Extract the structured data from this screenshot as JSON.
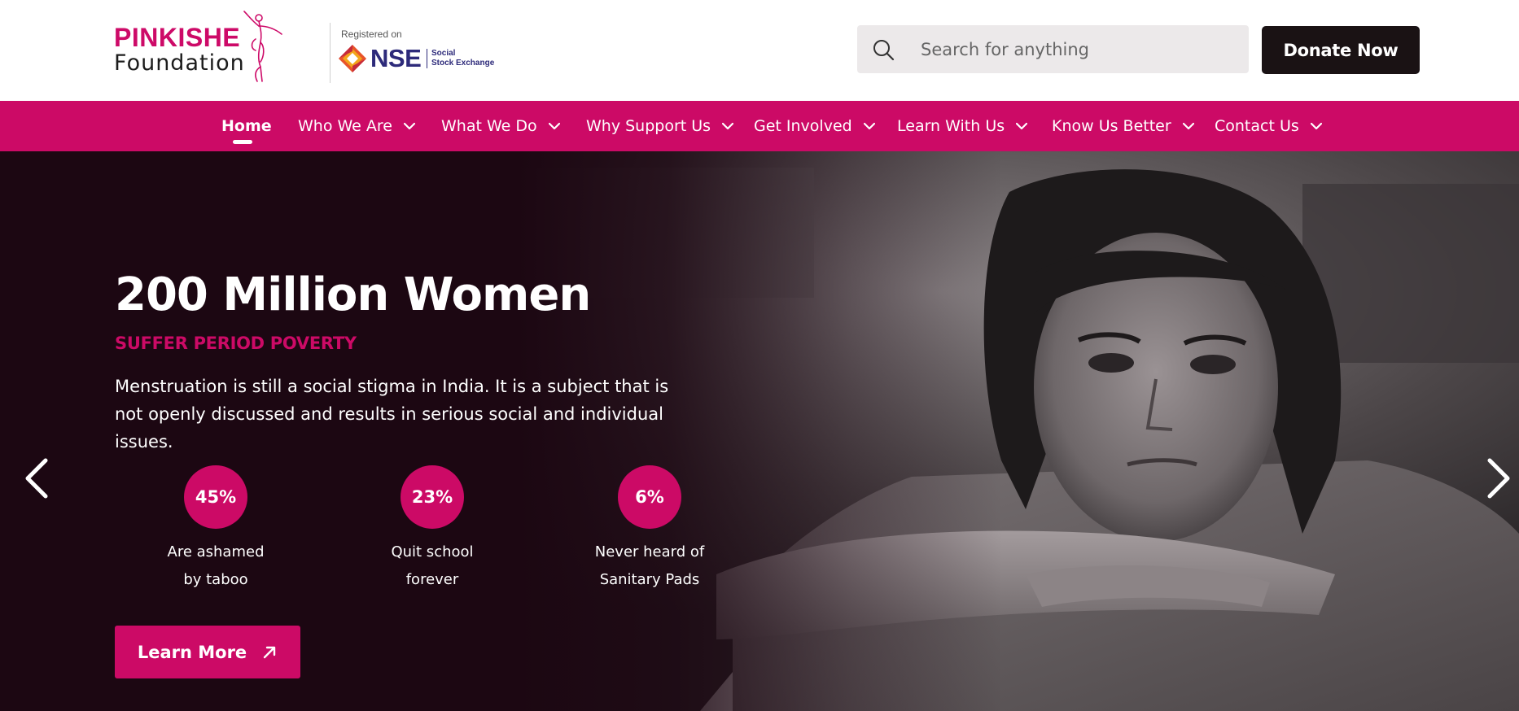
{
  "brand": {
    "name_line1": "PINKISHE",
    "name_line2": "Foundation",
    "registered_label": "Registered on",
    "nse_letters": "NSE",
    "nse_sub_line1": "Social",
    "nse_sub_line2": "Stock Exchange"
  },
  "search": {
    "placeholder": "Search for anything",
    "value": ""
  },
  "header": {
    "donate_label": "Donate Now"
  },
  "nav": {
    "items": [
      {
        "label": "Home",
        "active": true
      },
      {
        "label": "Who We Are"
      },
      {
        "label": "What We Do"
      },
      {
        "label": "Why Support Us"
      },
      {
        "label": "Get Involved"
      },
      {
        "label": "Learn With Us"
      },
      {
        "label": "Know Us Better"
      },
      {
        "label": "Contact Us"
      }
    ]
  },
  "hero": {
    "title": "200 Million Women",
    "subtitle": "SUFFER PERIOD POVERTY",
    "description": "Menstruation is still a social stigma in India. It is a subject that is not openly discussed and results in serious social and individual issues.",
    "stats": [
      {
        "value": "45%",
        "line1": "Are ashamed",
        "line2": "by taboo"
      },
      {
        "value": "23%",
        "line1": "Quit school",
        "line2": "forever"
      },
      {
        "value": "6%",
        "line1": "Never heard of",
        "line2": "Sanitary Pads"
      }
    ],
    "cta_label": "Learn More"
  },
  "colors": {
    "brand_pink": "#cc0a66",
    "dark": "#1a1214",
    "nse_blue": "#2d2a7a"
  }
}
